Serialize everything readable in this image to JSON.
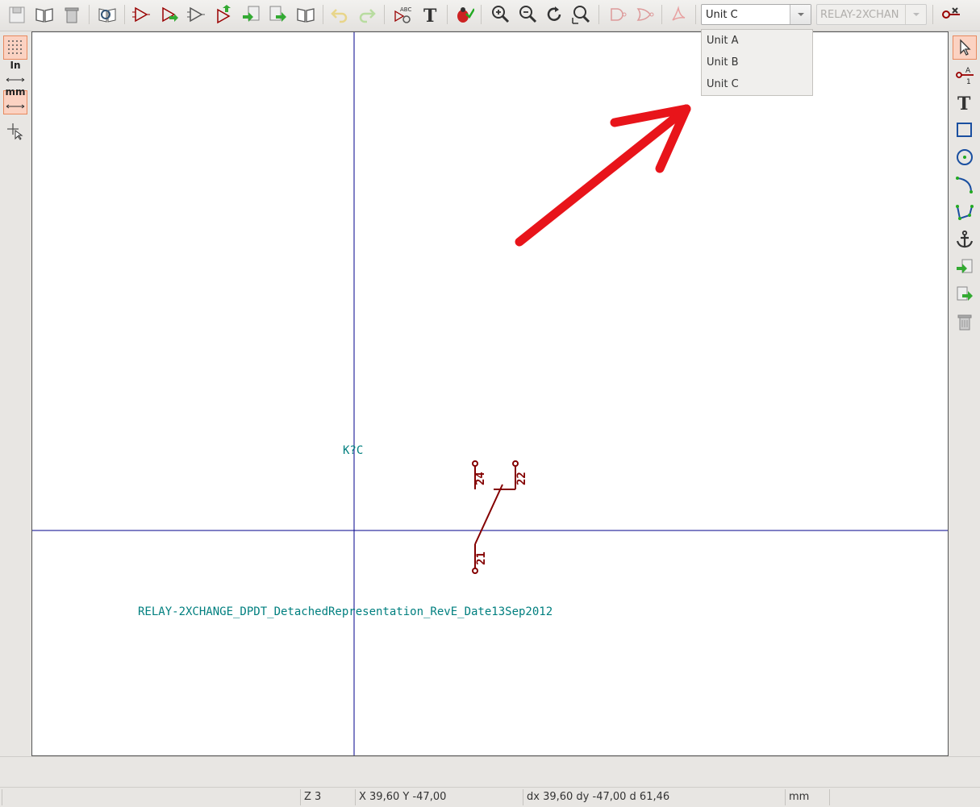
{
  "toolbar": {
    "icons": [
      "new-library-icon",
      "open-library-icon",
      "delete-library-icon",
      "browse-library-icon",
      "new-component-icon",
      "load-component-icon",
      "derived-component-icon",
      "save-component-icon",
      "import-icon",
      "export-icon",
      "library-book-icon",
      "undo-icon",
      "redo-icon",
      "edit-properties-icon",
      "text-icon",
      "erc-check-icon",
      "zoom-in-icon",
      "zoom-out-icon",
      "zoom-redraw-icon",
      "zoom-fit-icon",
      "de-morgan-normal-icon",
      "de-morgan-convert-icon",
      "datasheet-pdf-icon",
      "pin-table-icon"
    ],
    "unit_selected": "Unit C",
    "part_selected": "RELAY-2XCHAN"
  },
  "unit_dropdown": {
    "options": [
      "Unit A",
      "Unit B",
      "Unit C"
    ]
  },
  "left_toolbar": {
    "grid_label": "grid-icon",
    "inch_label": "In",
    "mm_label": "mm",
    "cursor_label": "cursor-icon"
  },
  "right_toolbar": {
    "icons": [
      "select-arrow-icon",
      "add-pin-icon",
      "add-text-icon",
      "add-rectangle-icon",
      "add-circle-icon",
      "add-arc-icon",
      "add-polyline-icon",
      "anchor-icon",
      "import-shape-icon",
      "export-shape-icon",
      "delete-icon"
    ],
    "pin_glyph": "A",
    "pin_glyph_num": "1"
  },
  "canvas": {
    "reference": "K?C",
    "value": "RELAY-2XCHANGE_DPDT_DetachedRepresentation_RevE_Date13Sep2012",
    "pins": [
      "24",
      "22",
      "21"
    ],
    "colors": {
      "pin": "#840000",
      "text": "#007f7f",
      "axis": "#00008b",
      "annotation": "#e8141a"
    }
  },
  "statusbar": {
    "zoom": "Z 3",
    "coords": "X 39,60  Y -47,00",
    "delta": "dx 39,60  dy -47,00  d 61,46",
    "units": "mm"
  }
}
